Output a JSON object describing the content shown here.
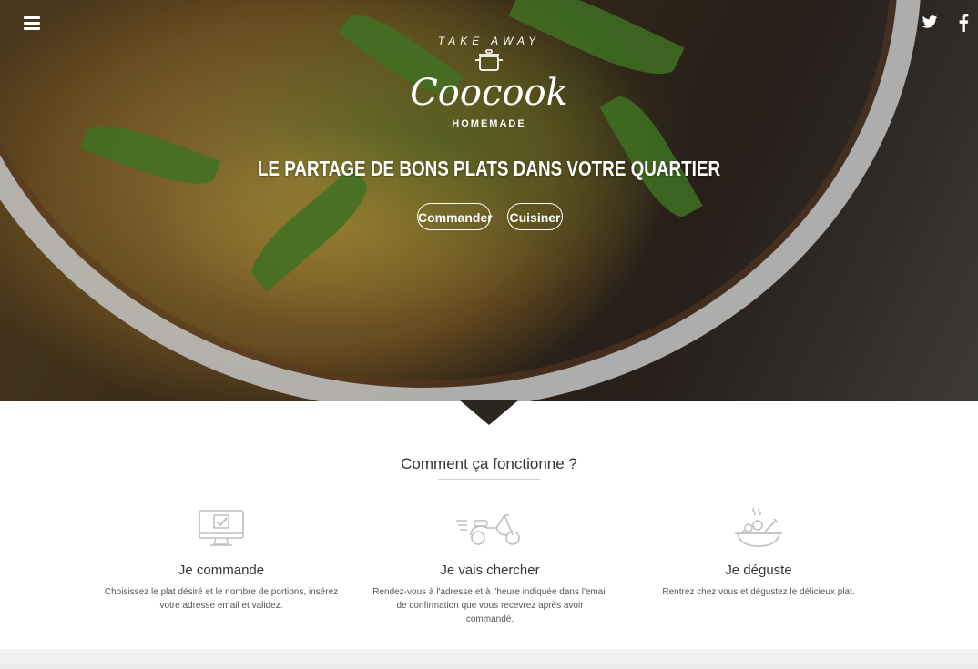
{
  "header": {
    "menu_icon": "hamburger-icon",
    "social": [
      {
        "name": "twitter",
        "icon": "twitter-icon"
      },
      {
        "name": "facebook",
        "icon": "facebook-icon"
      }
    ]
  },
  "logo": {
    "top_text": "TAKE AWAY",
    "brand": "Coocook",
    "bottom_text": "HOMEMADE"
  },
  "hero": {
    "tagline": "LE PARTAGE DE BONS PLATS DANS VOTRE QUARTIER",
    "buttons": {
      "order": "Commander",
      "cook": "Cuisiner"
    }
  },
  "how": {
    "title": "Comment ça fonctionne ?",
    "steps": [
      {
        "icon": "computer-check-icon",
        "title": "Je commande",
        "text": "Choisissez le plat désiré et le nombre de portions, insérez votre adresse email et validez."
      },
      {
        "icon": "scooter-icon",
        "title": "Je vais chercher",
        "text": "Rendez-vous à l'adresse et à l'heure indiquée dans l'email de confirmation que vous recevrez après avoir commandé."
      },
      {
        "icon": "dish-icon",
        "title": "Je déguste",
        "text": "Rentrez chez vous et dégustez le délicieux plat."
      }
    ]
  },
  "colors": {
    "text_dark": "#333333",
    "text_light": "#555555",
    "hero_overlay": "#2c2621",
    "icon_stroke": "#bdbdbd"
  }
}
